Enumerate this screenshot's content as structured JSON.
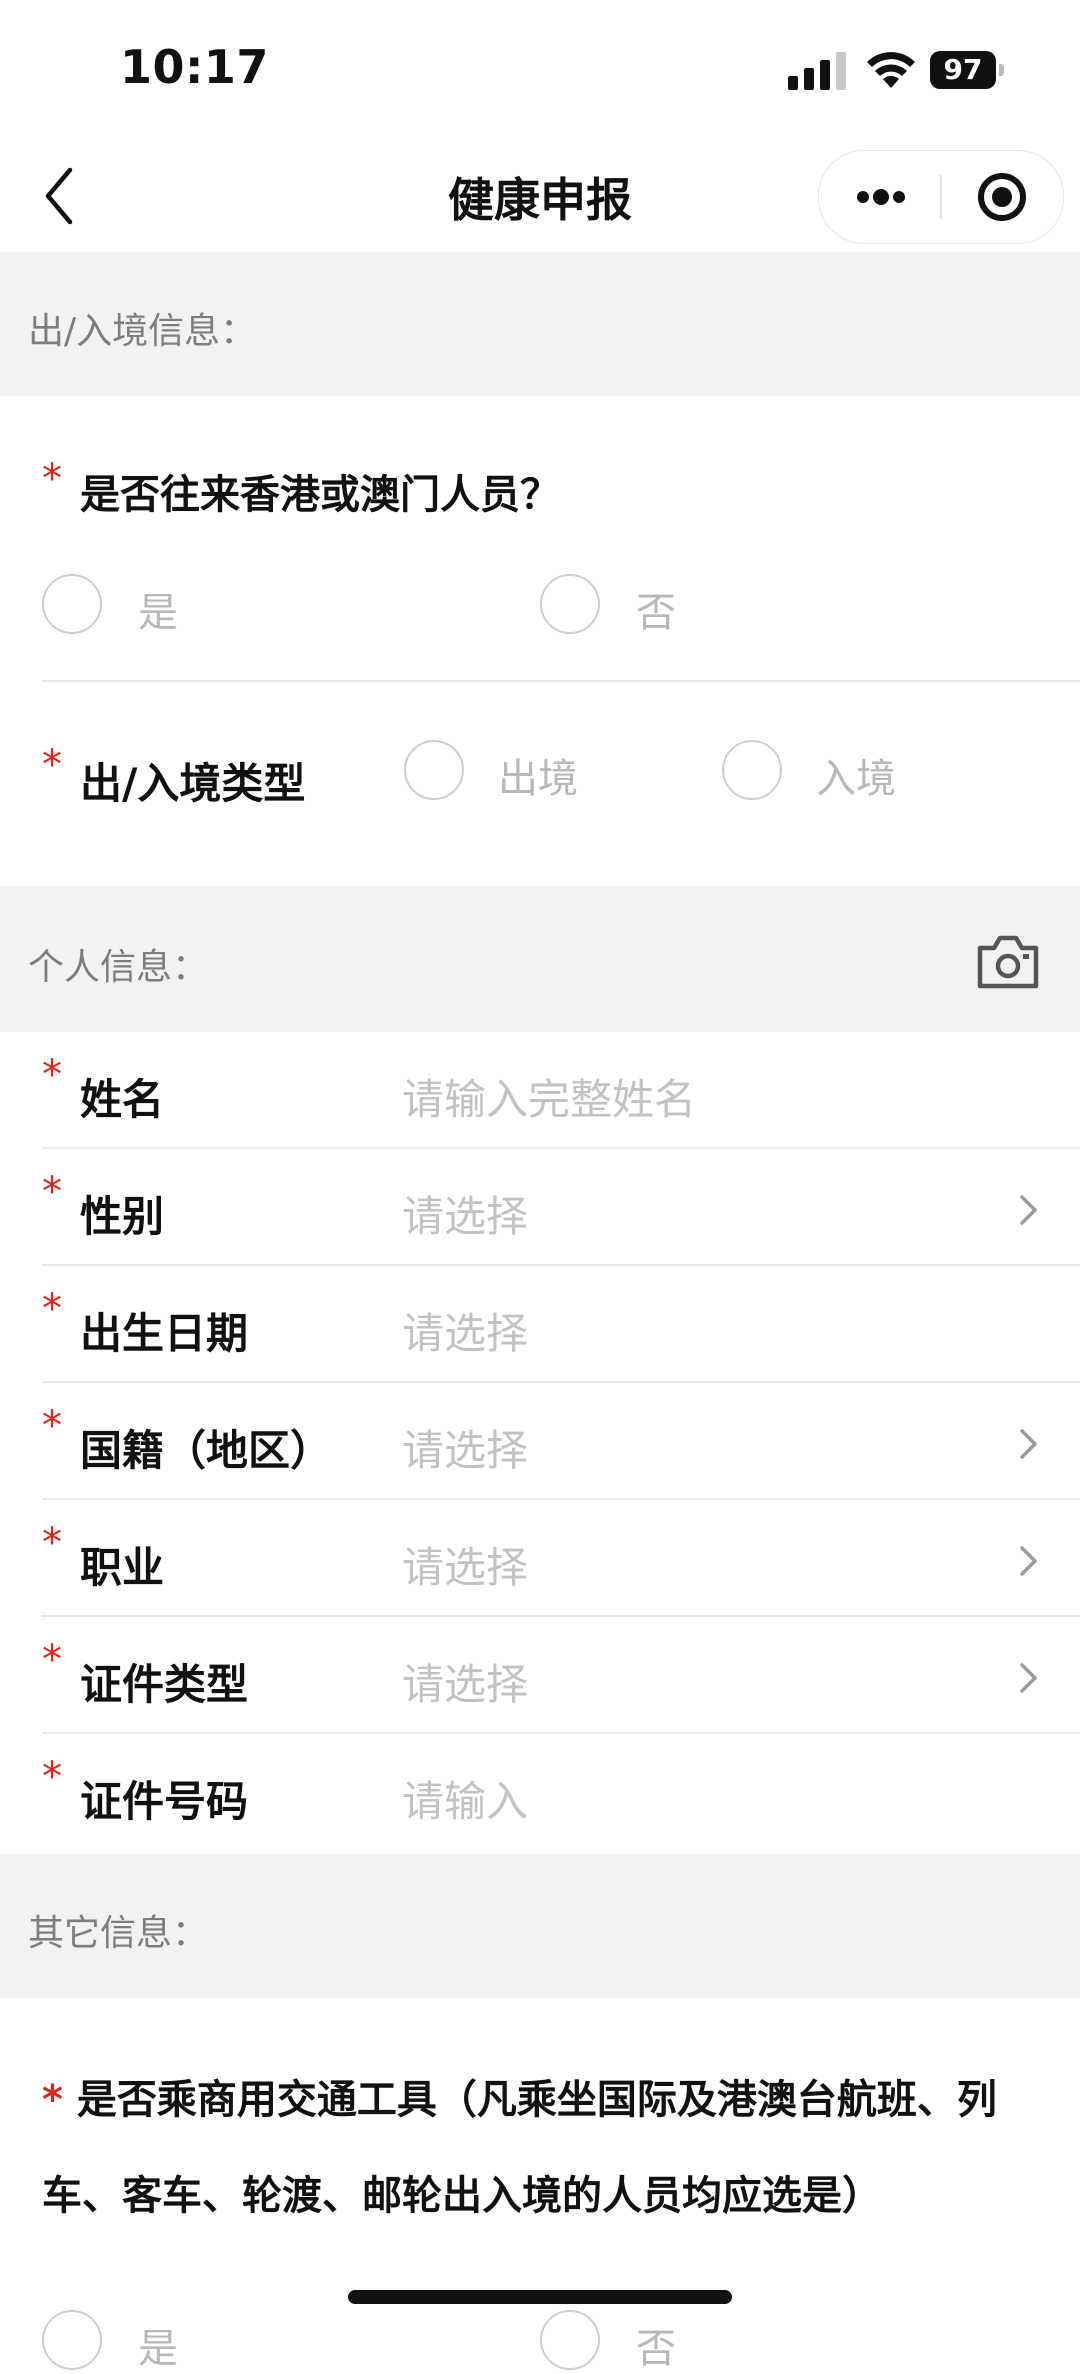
{
  "status_bar": {
    "time": "10:17",
    "battery": "97"
  },
  "nav": {
    "title": "健康申报"
  },
  "sections": {
    "entry_info": "出/入境信息：",
    "personal_info": "个人信息：",
    "other_info": "其它信息："
  },
  "q_hk_macau": {
    "label": "是否往来香港或澳门人员？",
    "options": [
      "是",
      "否"
    ]
  },
  "q_entry_type": {
    "label": "出/入境类型",
    "options": [
      "出境",
      "入境"
    ]
  },
  "personal_fields": [
    {
      "label": "姓名",
      "value": "请输入完整姓名"
    },
    {
      "label": "性别",
      "value": "请选择"
    },
    {
      "label": "出生日期",
      "value": "请选择"
    },
    {
      "label": "国籍（地区）",
      "value": "请选择"
    },
    {
      "label": "职业",
      "value": "请选择"
    },
    {
      "label": "证件类型",
      "value": "请选择"
    },
    {
      "label": "证件号码",
      "value": "请输入"
    }
  ],
  "q_transport": {
    "star": "*",
    "label": "是否乘商用交通工具（凡乘坐国际及港澳台航班、列车、客车、轮渡、邮轮出入境的人员均应选是）",
    "options": [
      "是",
      "否"
    ]
  },
  "colors": {
    "required": "#e2231a",
    "placeholder": "#c2c2c2",
    "section_bg": "#f2f2f2"
  },
  "icons": [
    "back-icon",
    "more-icon",
    "close-mini-program-icon",
    "camera-icon",
    "chevron-right-icon"
  ]
}
